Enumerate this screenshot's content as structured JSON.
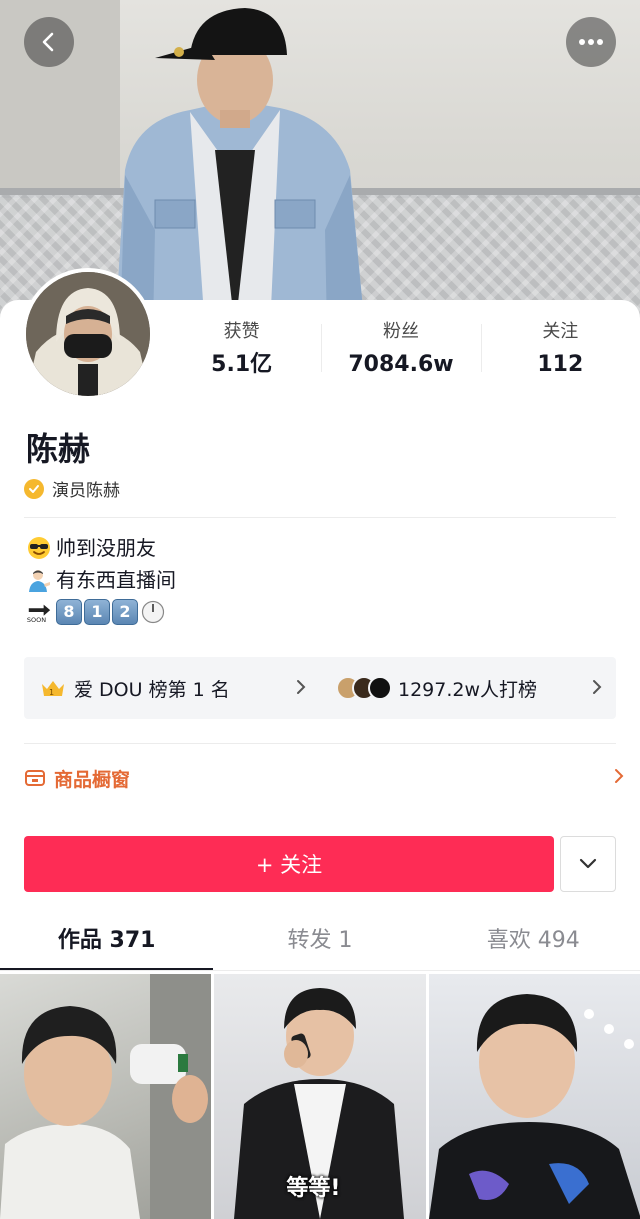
{
  "profile": {
    "name": "陈赫",
    "verification": "演员陈赫"
  },
  "stats": [
    {
      "label": "获赞",
      "value": "5.1亿"
    },
    {
      "label": "粉丝",
      "value": "7084.6w"
    },
    {
      "label": "关注",
      "value": "112"
    }
  ],
  "bio": {
    "line1": "帅到没朋友",
    "line2": "有东西直播间",
    "line3_keys": [
      "8",
      "1",
      "2"
    ]
  },
  "rank": {
    "left_label": "爱 DOU 榜第 1 名",
    "right_label": "1297.2w人打榜"
  },
  "shop": {
    "label": "商品橱窗"
  },
  "actions": {
    "follow_label": "+ 关注"
  },
  "tabs": [
    {
      "label": "作品 371",
      "active": true
    },
    {
      "label": "转发 1",
      "active": false
    },
    {
      "label": "喜欢 494",
      "active": false
    }
  ],
  "videos": [
    {
      "caption": ""
    },
    {
      "caption": "等等!"
    },
    {
      "caption": ""
    }
  ],
  "icons": {
    "back": "chevron-left-icon",
    "more": "more-dots-icon",
    "verify": "verified-badge-icon",
    "crown": "crown-icon",
    "shop": "shop-icon",
    "dropdown": "chevron-down-icon"
  },
  "colors": {
    "accent": "#fe2c55",
    "shop": "#e46a35",
    "verify": "#f5b82e"
  }
}
